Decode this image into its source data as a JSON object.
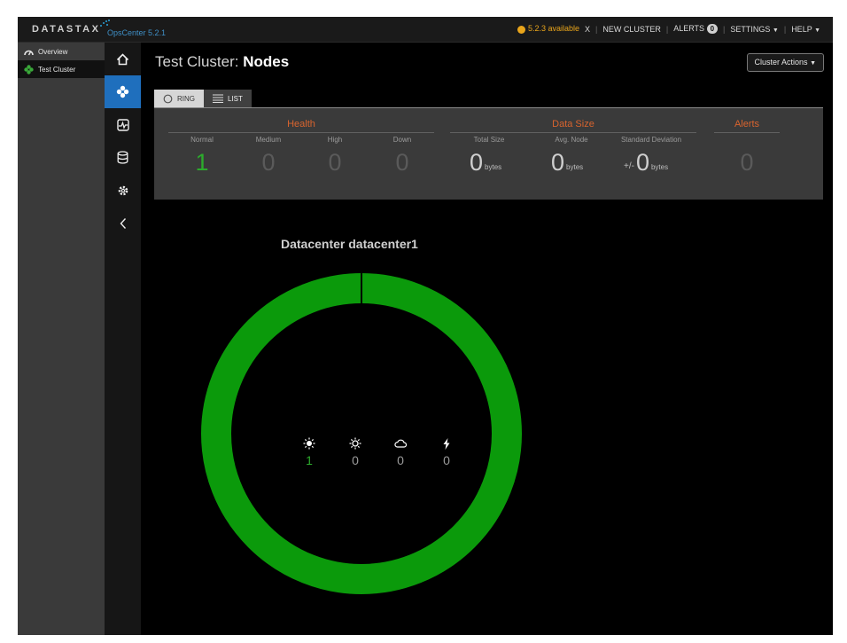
{
  "topbar": {
    "logo": "DATASTAX",
    "version": "OpsCenter 5.2.1",
    "update_text": "5.2.3 available",
    "update_close": "X",
    "new_cluster": "NEW CLUSTER",
    "alerts_label": "ALERTS",
    "alerts_count": "0",
    "settings": "SETTINGS",
    "help": "HELP",
    "separator": "|",
    "caret": "▼"
  },
  "sidebar": {
    "items": [
      {
        "label": "Overview",
        "icon": "gauge-icon"
      },
      {
        "label": "Test Cluster",
        "icon": "cluster-icon"
      }
    ]
  },
  "iconnav": [
    "home-icon",
    "nodes-icon",
    "activity-icon",
    "database-icon",
    "gear-icon",
    "chevron-left-icon"
  ],
  "page": {
    "title_prefix": "Test Cluster:",
    "title_main": "Nodes",
    "cluster_actions": "Cluster Actions",
    "caret": "▼"
  },
  "tabs": {
    "ring": "RING",
    "list": "LIST"
  },
  "stats": {
    "health": {
      "title": "Health",
      "labels": [
        "Normal",
        "Medium",
        "High",
        "Down"
      ],
      "values": [
        "1",
        "0",
        "0",
        "0"
      ]
    },
    "data_size": {
      "title": "Data Size",
      "labels": [
        "Total Size",
        "Avg. Node",
        "Standard Deviation"
      ],
      "values": [
        "0",
        "0",
        "0"
      ],
      "unit": "bytes",
      "plusminus": "+/-"
    },
    "alerts": {
      "title": "Alerts",
      "value": "0"
    }
  },
  "datacenter": {
    "title": "Datacenter datacenter1",
    "ring_color": "#0b9a0b",
    "status": [
      {
        "icon": "sun-icon",
        "value": "1"
      },
      {
        "icon": "partly-sunny-icon",
        "value": "0"
      },
      {
        "icon": "cloud-icon",
        "value": "0"
      },
      {
        "icon": "lightning-icon",
        "value": "0"
      }
    ]
  },
  "colors": {
    "accent_blue": "#1f6fbd",
    "orange": "#d9642e",
    "green": "#2cab2c"
  }
}
